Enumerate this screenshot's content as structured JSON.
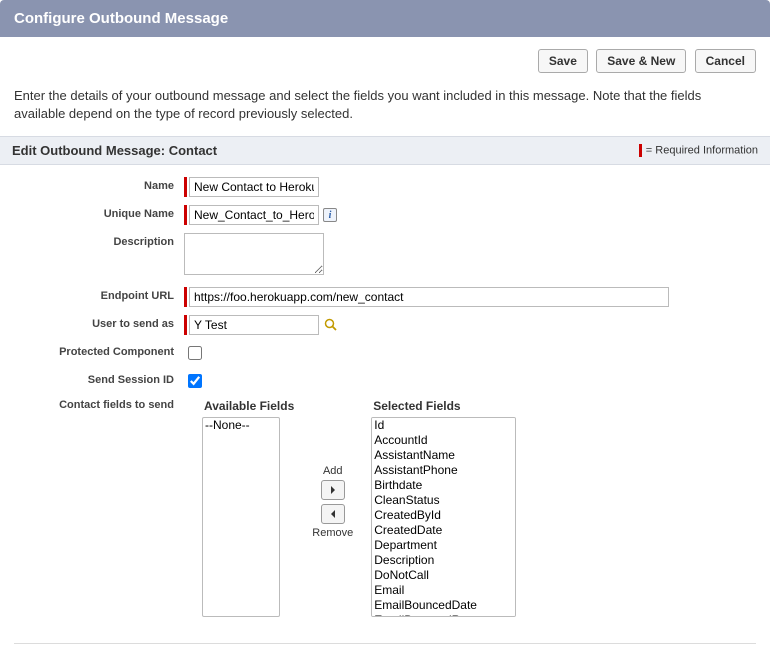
{
  "header": {
    "title": "Configure Outbound Message"
  },
  "buttons": {
    "save": "Save",
    "save_new": "Save & New",
    "cancel": "Cancel"
  },
  "intro": "Enter the details of your outbound message and select the fields you want included in this message. Note that the fields available depend on the type of record previously selected.",
  "section": {
    "title": "Edit Outbound Message: Contact",
    "required_text": "= Required Information"
  },
  "labels": {
    "name": "Name",
    "unique_name": "Unique Name",
    "description": "Description",
    "endpoint_url": "Endpoint URL",
    "user_to_send_as": "User to send as",
    "protected_component": "Protected Component",
    "send_session_id": "Send Session ID",
    "contact_fields_to_send": "Contact fields to send"
  },
  "values": {
    "name": "New Contact to Heroku",
    "unique_name": "New_Contact_to_Heroku",
    "description": "",
    "endpoint_url": "https://foo.herokuapp.com/new_contact",
    "user_to_send_as": "Y Test",
    "protected_component": false,
    "send_session_id": true
  },
  "multiselect": {
    "available_label": "Available Fields",
    "selected_label": "Selected Fields",
    "add_label": "Add",
    "remove_label": "Remove",
    "available": [
      "--None--"
    ],
    "selected": [
      "Id",
      "AccountId",
      "AssistantName",
      "AssistantPhone",
      "Birthdate",
      "CleanStatus",
      "CreatedById",
      "CreatedDate",
      "Department",
      "Description",
      "DoNotCall",
      "Email",
      "EmailBouncedDate",
      "EmailBouncedReason"
    ]
  }
}
